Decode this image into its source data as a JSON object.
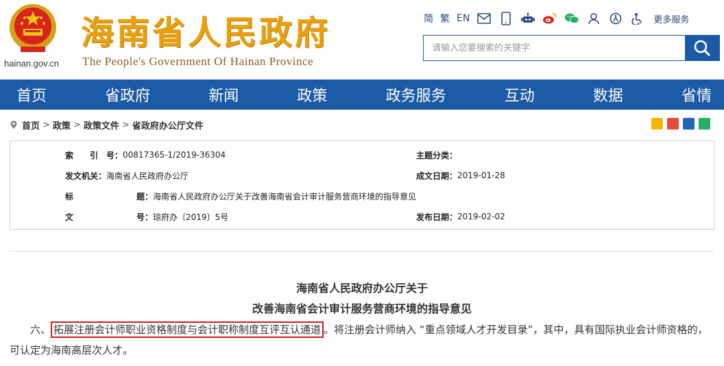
{
  "header": {
    "title_cn": "海南省人民政府",
    "title_en": "The People's Government Of Hainan Province",
    "domain": "hainan.gov.cn",
    "toolbar": {
      "simplified": "简",
      "traditional": "繁",
      "english": "EN",
      "more": "更多服务"
    },
    "search": {
      "placeholder": "请输入您要搜索的关键字"
    }
  },
  "nav": {
    "items": [
      "首页",
      "省政府",
      "新闻",
      "政策",
      "政务服务",
      "互动",
      "数据",
      "省情"
    ]
  },
  "breadcrumb": {
    "items": [
      "首页",
      "政策",
      "政策文件",
      "省政府办公厅文件"
    ],
    "separator": ">"
  },
  "info": {
    "index_label": "索　　引　号：",
    "index_value": "00817365-1/2019-36304",
    "topic_label": "主题分类：",
    "topic_value": "",
    "issuer_label": "发文机关：",
    "issuer_value": "海南省人民政府办公厅",
    "date_created_label": "成文日期：",
    "date_created_value": "2019-01-28",
    "title_label_a": "标",
    "title_label_b": "题：",
    "title_value": "海南省人民政府办公厅关于改善海南省会计审计服务营商环境的指导意见",
    "docno_label_a": "文",
    "docno_label_b": "号：",
    "docno_value": "琼府办〔2019〕5号",
    "date_pub_label": "发布日期：",
    "date_pub_value": "2019-02-02"
  },
  "article": {
    "title_line1": "海南省人民政府办公厅关于",
    "title_line2": "改善海南省会计审计服务营商环境的指导意见",
    "para_prefix": "六、",
    "para_highlight": "拓展注册会计师职业资格制度与会计职称制度互评互认通道",
    "para_rest": "。将注册会计师纳入 “重点领域人才开发目录”，其中，具有国际执业会计师资格的，可认定为海南高层次人才。"
  },
  "colors": {
    "nav_bg": "#1b5aa5",
    "title_gold": "#e8a10e",
    "highlight_border": "#d21a1a"
  }
}
